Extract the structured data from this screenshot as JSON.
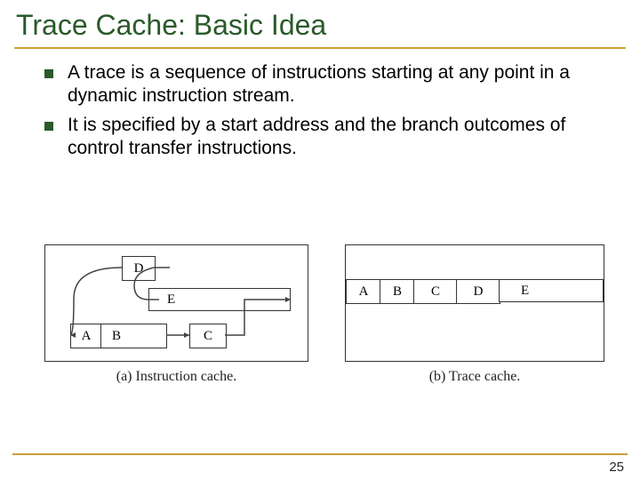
{
  "title": "Trace Cache: Basic Idea",
  "bullets": [
    "A trace is a sequence of instructions starting at any point in a dynamic instruction stream.",
    "It is specified by a start address and the branch outcomes of control transfer instructions."
  ],
  "fig_a": {
    "blocks": {
      "A": "A",
      "B": "B",
      "C": "C",
      "D": "D",
      "E": "E"
    },
    "caption": "(a) Instruction cache."
  },
  "fig_b": {
    "cells": [
      "A",
      "B",
      "C",
      "D",
      "E"
    ],
    "caption": "(b) Trace cache."
  },
  "page_number": "25"
}
